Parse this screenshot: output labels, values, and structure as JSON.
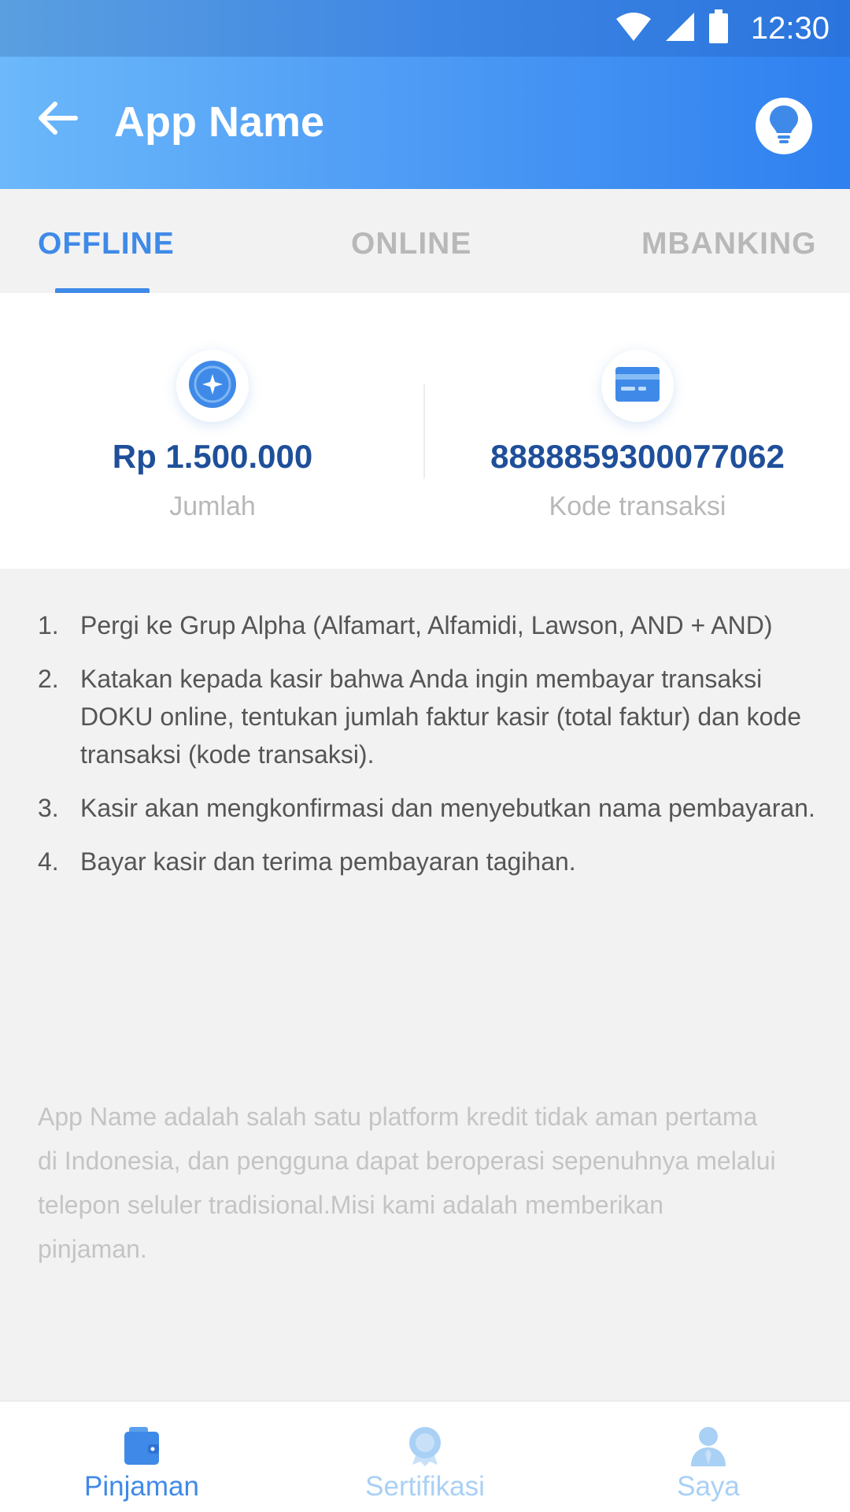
{
  "status_bar": {
    "time": "12:30",
    "icons": [
      "wifi-icon",
      "signal-icon",
      "battery-icon"
    ]
  },
  "app_bar": {
    "title": "App Name",
    "back_icon": "arrow-left-icon",
    "help_icon": "lightbulb-icon"
  },
  "tabs": [
    {
      "label": "OFFLINE",
      "active": true
    },
    {
      "label": "ONLINE",
      "active": false
    },
    {
      "label": "MBANKING",
      "active": false
    }
  ],
  "info": {
    "amount": {
      "value": "Rp 1.500.000",
      "label": "Jumlah",
      "icon": "coin-icon"
    },
    "code": {
      "value": "8888859300077062",
      "label": "Kode transaksi",
      "icon": "card-icon"
    }
  },
  "steps": [
    {
      "num": "1.",
      "text": "Pergi ke Grup Alpha (Alfamart, Alfamidi, Lawson, AND + AND)"
    },
    {
      "num": "2.",
      "text": "Katakan kepada kasir bahwa Anda ingin membayar transaksi DOKU online, tentukan jumlah faktur kasir (total faktur) dan kode transaksi (kode transaksi)."
    },
    {
      "num": "3.",
      "text": "Kasir akan mengkonfirmasi dan menyebutkan nama pembayaran."
    },
    {
      "num": "4.",
      "text": "Bayar kasir dan terima pembayaran tagihan."
    }
  ],
  "about": "App Name adalah salah satu platform kredit tidak aman pertama di Indonesia, dan pengguna dapat beroperasi sepenuhnya melalui telepon seluler tradisional.Misi kami adalah memberikan pinjaman.",
  "bottom_nav": [
    {
      "label": "Pinjaman",
      "icon": "wallet-icon",
      "active": true
    },
    {
      "label": "Sertifikasi",
      "icon": "medal-icon",
      "active": false
    },
    {
      "label": "Saya",
      "icon": "user-icon",
      "active": false
    }
  ],
  "colors": {
    "accent": "#3f8ae8",
    "value_text": "#1f4f9a",
    "inactive_tab": "#b8b8b8"
  }
}
